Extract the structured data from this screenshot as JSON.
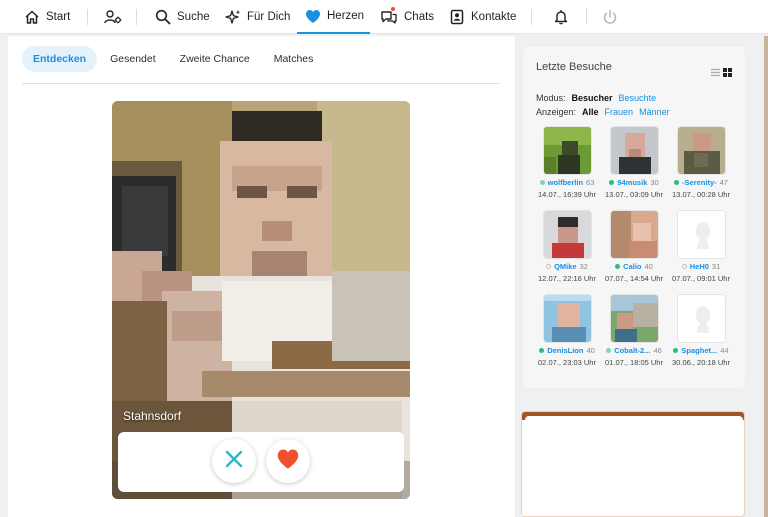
{
  "nav": {
    "start": "Start",
    "suche": "Suche",
    "fuer_dich": "Für Dich",
    "herzen": "Herzen",
    "chats": "Chats",
    "kontakte": "Kontakte"
  },
  "tabs": [
    "Entdecken",
    "Gesendet",
    "Zweite Chance",
    "Matches"
  ],
  "active_tab": "Entdecken",
  "card": {
    "city": "Stahnsdorf"
  },
  "sidebar": {
    "title": "Letzte Besuche",
    "modus_label": "Modus:",
    "modus_options": [
      "Besucher",
      "Besuchte"
    ],
    "anzeigen_label": "Anzeigen:",
    "anzeigen_options": [
      "Alle",
      "Frauen",
      "Männer"
    ],
    "visitors": [
      {
        "name": "wolfberlin",
        "age": "63",
        "time": "14.07., 16:39 Uhr",
        "status": "rec"
      },
      {
        "name": "94musik",
        "age": "30",
        "time": "13.07., 03:09 Uhr",
        "status": "on"
      },
      {
        "name": "-Serenity-",
        "age": "47",
        "time": "13.07., 00:28 Uhr",
        "status": "on"
      },
      {
        "name": "QMike",
        "age": "32",
        "time": "12.07., 22:16 Uhr",
        "status": "off"
      },
      {
        "name": "Calio",
        "age": "40",
        "time": "07.07., 14:54 Uhr",
        "status": "on"
      },
      {
        "name": "HeH0",
        "age": "31",
        "time": "07.07., 09:01 Uhr",
        "status": "off"
      },
      {
        "name": "DenisLion",
        "age": "40",
        "time": "02.07., 23:03 Uhr",
        "status": "on"
      },
      {
        "name": "Cobalt-2...",
        "age": "46",
        "time": "01.07., 18:05 Uhr",
        "status": "rec"
      },
      {
        "name": "Spaghet...",
        "age": "44",
        "time": "30.06., 20:18 Uhr",
        "status": "on"
      }
    ]
  },
  "colors": {
    "accent": "#1c8fe0",
    "like": "#f0502e",
    "dislike": "#2bb6c8",
    "online": "#23c27a"
  }
}
